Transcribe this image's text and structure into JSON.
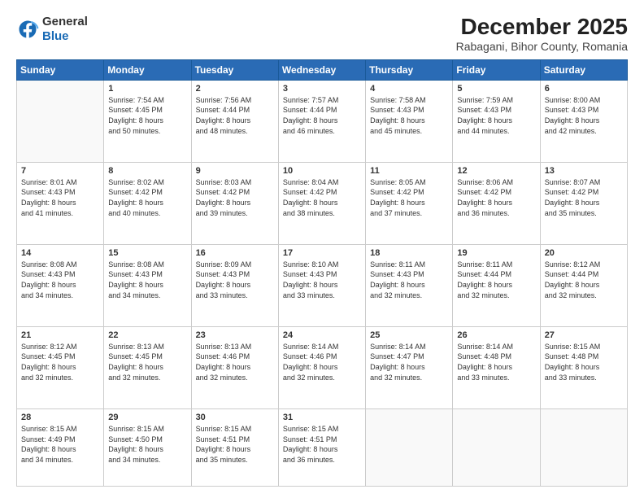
{
  "header": {
    "logo": {
      "line1": "General",
      "line2": "Blue"
    },
    "title": "December 2025",
    "subtitle": "Rabagani, Bihor County, Romania"
  },
  "days_of_week": [
    "Sunday",
    "Monday",
    "Tuesday",
    "Wednesday",
    "Thursday",
    "Friday",
    "Saturday"
  ],
  "weeks": [
    [
      {
        "num": "",
        "detail": ""
      },
      {
        "num": "1",
        "detail": "Sunrise: 7:54 AM\nSunset: 4:45 PM\nDaylight: 8 hours\nand 50 minutes."
      },
      {
        "num": "2",
        "detail": "Sunrise: 7:56 AM\nSunset: 4:44 PM\nDaylight: 8 hours\nand 48 minutes."
      },
      {
        "num": "3",
        "detail": "Sunrise: 7:57 AM\nSunset: 4:44 PM\nDaylight: 8 hours\nand 46 minutes."
      },
      {
        "num": "4",
        "detail": "Sunrise: 7:58 AM\nSunset: 4:43 PM\nDaylight: 8 hours\nand 45 minutes."
      },
      {
        "num": "5",
        "detail": "Sunrise: 7:59 AM\nSunset: 4:43 PM\nDaylight: 8 hours\nand 44 minutes."
      },
      {
        "num": "6",
        "detail": "Sunrise: 8:00 AM\nSunset: 4:43 PM\nDaylight: 8 hours\nand 42 minutes."
      }
    ],
    [
      {
        "num": "7",
        "detail": "Sunrise: 8:01 AM\nSunset: 4:43 PM\nDaylight: 8 hours\nand 41 minutes."
      },
      {
        "num": "8",
        "detail": "Sunrise: 8:02 AM\nSunset: 4:42 PM\nDaylight: 8 hours\nand 40 minutes."
      },
      {
        "num": "9",
        "detail": "Sunrise: 8:03 AM\nSunset: 4:42 PM\nDaylight: 8 hours\nand 39 minutes."
      },
      {
        "num": "10",
        "detail": "Sunrise: 8:04 AM\nSunset: 4:42 PM\nDaylight: 8 hours\nand 38 minutes."
      },
      {
        "num": "11",
        "detail": "Sunrise: 8:05 AM\nSunset: 4:42 PM\nDaylight: 8 hours\nand 37 minutes."
      },
      {
        "num": "12",
        "detail": "Sunrise: 8:06 AM\nSunset: 4:42 PM\nDaylight: 8 hours\nand 36 minutes."
      },
      {
        "num": "13",
        "detail": "Sunrise: 8:07 AM\nSunset: 4:42 PM\nDaylight: 8 hours\nand 35 minutes."
      }
    ],
    [
      {
        "num": "14",
        "detail": "Sunrise: 8:08 AM\nSunset: 4:43 PM\nDaylight: 8 hours\nand 34 minutes."
      },
      {
        "num": "15",
        "detail": "Sunrise: 8:08 AM\nSunset: 4:43 PM\nDaylight: 8 hours\nand 34 minutes."
      },
      {
        "num": "16",
        "detail": "Sunrise: 8:09 AM\nSunset: 4:43 PM\nDaylight: 8 hours\nand 33 minutes."
      },
      {
        "num": "17",
        "detail": "Sunrise: 8:10 AM\nSunset: 4:43 PM\nDaylight: 8 hours\nand 33 minutes."
      },
      {
        "num": "18",
        "detail": "Sunrise: 8:11 AM\nSunset: 4:43 PM\nDaylight: 8 hours\nand 32 minutes."
      },
      {
        "num": "19",
        "detail": "Sunrise: 8:11 AM\nSunset: 4:44 PM\nDaylight: 8 hours\nand 32 minutes."
      },
      {
        "num": "20",
        "detail": "Sunrise: 8:12 AM\nSunset: 4:44 PM\nDaylight: 8 hours\nand 32 minutes."
      }
    ],
    [
      {
        "num": "21",
        "detail": "Sunrise: 8:12 AM\nSunset: 4:45 PM\nDaylight: 8 hours\nand 32 minutes."
      },
      {
        "num": "22",
        "detail": "Sunrise: 8:13 AM\nSunset: 4:45 PM\nDaylight: 8 hours\nand 32 minutes."
      },
      {
        "num": "23",
        "detail": "Sunrise: 8:13 AM\nSunset: 4:46 PM\nDaylight: 8 hours\nand 32 minutes."
      },
      {
        "num": "24",
        "detail": "Sunrise: 8:14 AM\nSunset: 4:46 PM\nDaylight: 8 hours\nand 32 minutes."
      },
      {
        "num": "25",
        "detail": "Sunrise: 8:14 AM\nSunset: 4:47 PM\nDaylight: 8 hours\nand 32 minutes."
      },
      {
        "num": "26",
        "detail": "Sunrise: 8:14 AM\nSunset: 4:48 PM\nDaylight: 8 hours\nand 33 minutes."
      },
      {
        "num": "27",
        "detail": "Sunrise: 8:15 AM\nSunset: 4:48 PM\nDaylight: 8 hours\nand 33 minutes."
      }
    ],
    [
      {
        "num": "28",
        "detail": "Sunrise: 8:15 AM\nSunset: 4:49 PM\nDaylight: 8 hours\nand 34 minutes."
      },
      {
        "num": "29",
        "detail": "Sunrise: 8:15 AM\nSunset: 4:50 PM\nDaylight: 8 hours\nand 34 minutes."
      },
      {
        "num": "30",
        "detail": "Sunrise: 8:15 AM\nSunset: 4:51 PM\nDaylight: 8 hours\nand 35 minutes."
      },
      {
        "num": "31",
        "detail": "Sunrise: 8:15 AM\nSunset: 4:51 PM\nDaylight: 8 hours\nand 36 minutes."
      },
      {
        "num": "",
        "detail": ""
      },
      {
        "num": "",
        "detail": ""
      },
      {
        "num": "",
        "detail": ""
      }
    ]
  ]
}
